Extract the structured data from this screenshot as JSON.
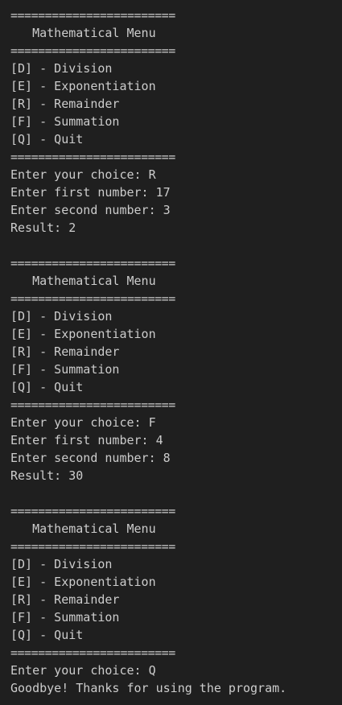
{
  "terminal": {
    "lines": [
      "========================",
      "   Mathematical Menu",
      "========================",
      "[D] - Division",
      "[E] - Exponentiation",
      "[R] - Remainder",
      "[F] - Summation",
      "[Q] - Quit",
      "========================",
      "Enter your choice: R",
      "Enter first number: 17",
      "Enter second number: 3",
      "Result: 2",
      "",
      "========================",
      "   Mathematical Menu",
      "========================",
      "[D] - Division",
      "[E] - Exponentiation",
      "[R] - Remainder",
      "[F] - Summation",
      "[Q] - Quit",
      "========================",
      "Enter your choice: F",
      "Enter first number: 4",
      "Enter second number: 8",
      "Result: 30",
      "",
      "========================",
      "   Mathematical Menu",
      "========================",
      "[D] - Division",
      "[E] - Exponentiation",
      "[R] - Remainder",
      "[F] - Summation",
      "[Q] - Quit",
      "========================",
      "Enter your choice: Q",
      "Goodbye! Thanks for using the program."
    ]
  },
  "colors": {
    "background": "#1f1f1f",
    "text": "#cccccc"
  }
}
